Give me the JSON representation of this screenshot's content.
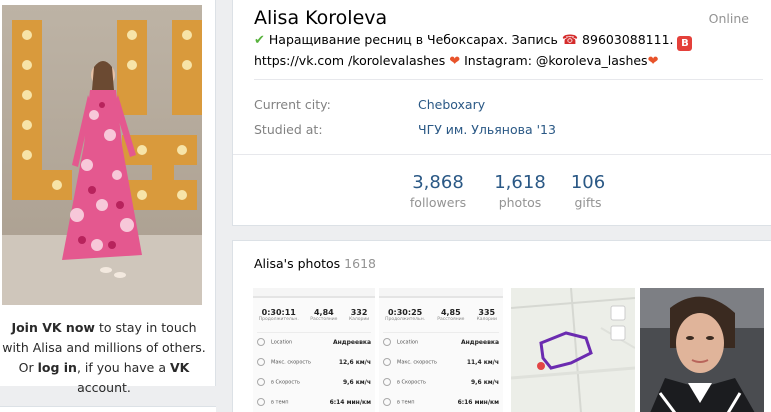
{
  "profile": {
    "name": "Alisa Koroleva",
    "online": "Online",
    "status_check": "✔",
    "status_text1": " Наращивание ресниц в Чебоксарах. Запись ",
    "status_phone_icon": "☎",
    "status_phone": " 89603088111. ",
    "status_b": "B",
    "status_text2": " https://vk.com /korolevalashes ",
    "status_heart": "❤",
    "status_text3": " Instagram: @koroleva_lashes",
    "status_heart2": "❤"
  },
  "info": [
    {
      "label": "Current city:",
      "value": "Cheboxary"
    },
    {
      "label": "Studied at:",
      "value": "ЧГУ им. Ульянова '13"
    }
  ],
  "counters": [
    {
      "num": "3,868",
      "label": "followers"
    },
    {
      "num": "1,618",
      "label": "photos"
    },
    {
      "num": "106",
      "label": "gifts"
    }
  ],
  "join": {
    "join_link": "Join VK now",
    "text1": " to stay in touch with Alisa and millions of others. Or ",
    "login_link": "log in",
    "text2": ", if you have a ",
    "vk": "VK",
    "text3": " account."
  },
  "photos": {
    "title": "Alisa's photos",
    "count": "1618",
    "thumb1": {
      "time": "0:30:11",
      "time_l": "Продолжительн.",
      "dist": "4,84",
      "dist_l": "Расстояние",
      "cal": "332",
      "cal_l": "Калории",
      "location_l": "Location",
      "location_v": "Андреевка",
      "max_l": "Макс. скорость",
      "max_v": "12,6 км/ч",
      "avg_l": "в Скорость",
      "avg_v": "9,6 км/ч",
      "pace_l": "в темп",
      "pace_v": "6:14 мин/км"
    },
    "thumb2": {
      "time": "0:30:25",
      "time_l": "Продолжительн.",
      "dist": "4,85",
      "dist_l": "Расстояние",
      "cal": "335",
      "cal_l": "Калории",
      "location_l": "Location",
      "location_v": "Андреевка",
      "max_l": "Макс. скорость",
      "max_v": "11,4 км/ч",
      "avg_l": "в Скорость",
      "avg_v": "9,6 км/ч",
      "pace_l": "в темп",
      "pace_v": "6:16 мин/км"
    }
  },
  "colors": {
    "link": "#2a5885",
    "page_bg": "#edeef0",
    "muted": "#939393"
  }
}
